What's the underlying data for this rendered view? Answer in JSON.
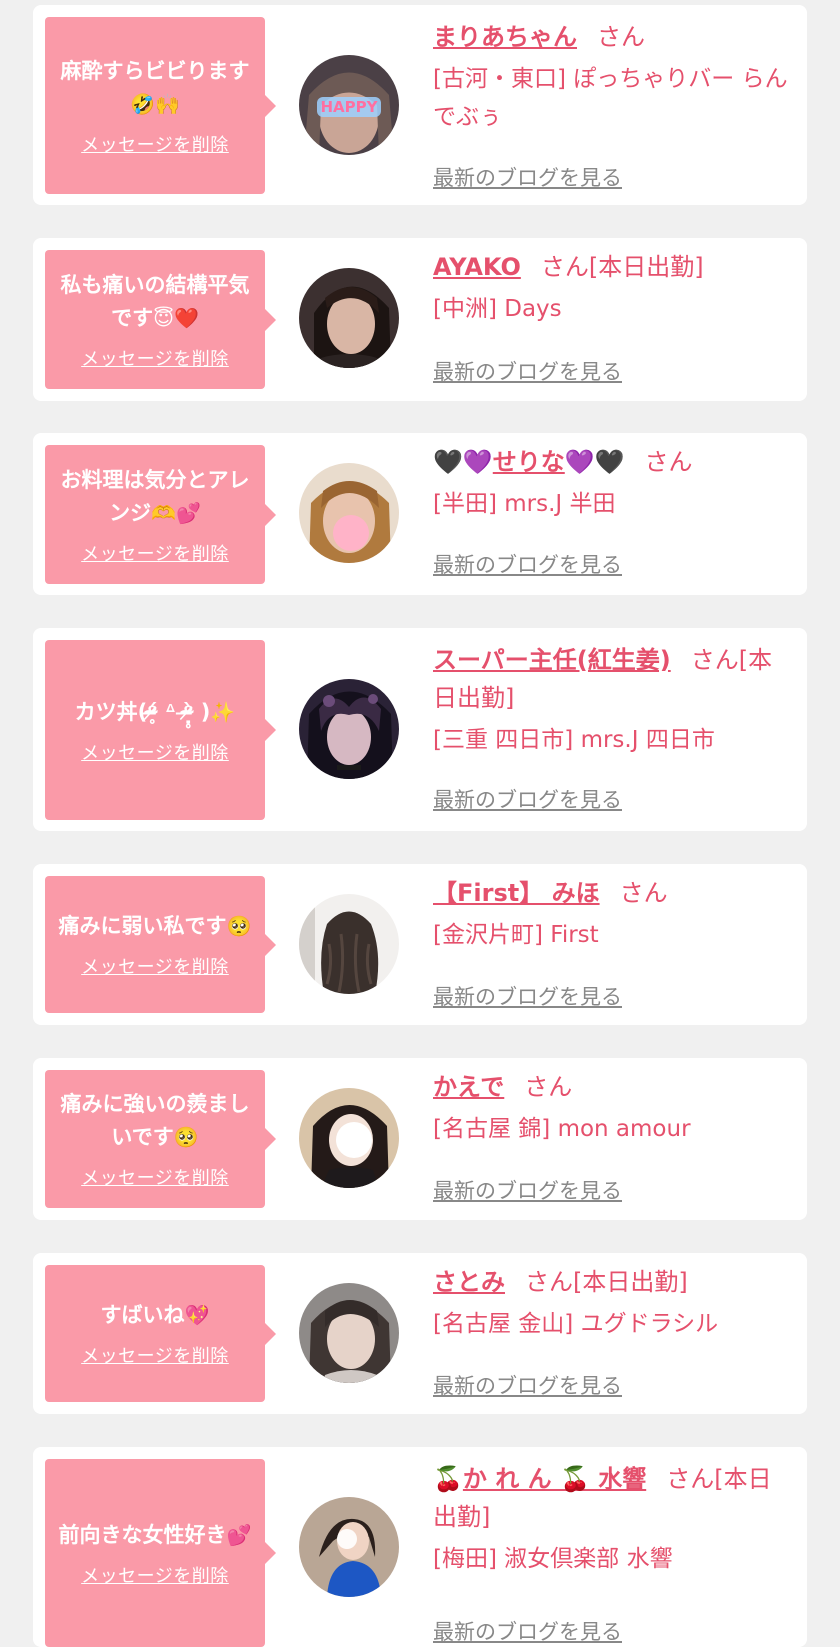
{
  "colors": {
    "page_bg": "#f0f0f0",
    "card_bg": "#ffffff",
    "bubble": "#fa9aa8",
    "accent": "#e5506c",
    "muted": "#888888"
  },
  "common": {
    "delete_label": "メッセージを削除",
    "blog_label": "最新のブログを見る",
    "san": "さん"
  },
  "items": [
    {
      "message": "麻酔すらビビります",
      "emoji": "🤣🙌",
      "name": "まりあちゃん",
      "status": "",
      "shop": "[古河・東口] ぽっちゃりバー らんでぶぅ",
      "avatar_icon": "happy-selfie"
    },
    {
      "message": "私も痛いの結構平気です",
      "emoji": "😇❤️",
      "name": "AYAKO",
      "status": "[本日出勤]",
      "shop": "[中洲] Days",
      "avatar_icon": "portrait"
    },
    {
      "message": "お料理は気分とアレンジ",
      "emoji": "🫶💕",
      "name_prefix": "🖤💜",
      "name": "せりな",
      "name_suffix": "💜🖤",
      "status": "",
      "shop": "[半田] mrs.J 半田",
      "avatar_icon": "portrait-blur"
    },
    {
      "message": "カツ丼(ᵒ̴̶̷̥́ ᐞ ᵒ̴̶̷̣̥̀ )",
      "emoji": "✨",
      "name": "スーパー主任(紅生姜)",
      "status": "[本日出勤]",
      "shop": "[三重 四日市] mrs.J 四日市",
      "avatar_icon": "anime-portrait"
    },
    {
      "message": "痛みに弱い私です",
      "emoji": "🥺",
      "name": "【First】 みほ",
      "status": "",
      "shop": "[金沢片町] First",
      "avatar_icon": "hair-back"
    },
    {
      "message": "痛みに強いの羨ましいです",
      "emoji": "🥺",
      "name": "かえで",
      "status": "",
      "shop": "[名古屋 錦] mon amour",
      "avatar_icon": "portrait-blur"
    },
    {
      "message": "すばいね",
      "emoji": "💖",
      "name": "さとみ",
      "status": "[本日出勤]",
      "shop": "[名古屋 金山] ユグドラシル",
      "avatar_icon": "portrait"
    },
    {
      "message": "前向きな女性好き",
      "emoji": "💕",
      "name_prefix": "🍒",
      "name": "か れ ん 🍒 水響",
      "status": "[本日出勤]",
      "shop": "[梅田] 淑女倶楽部 水響",
      "avatar_icon": "portrait-blue"
    }
  ]
}
